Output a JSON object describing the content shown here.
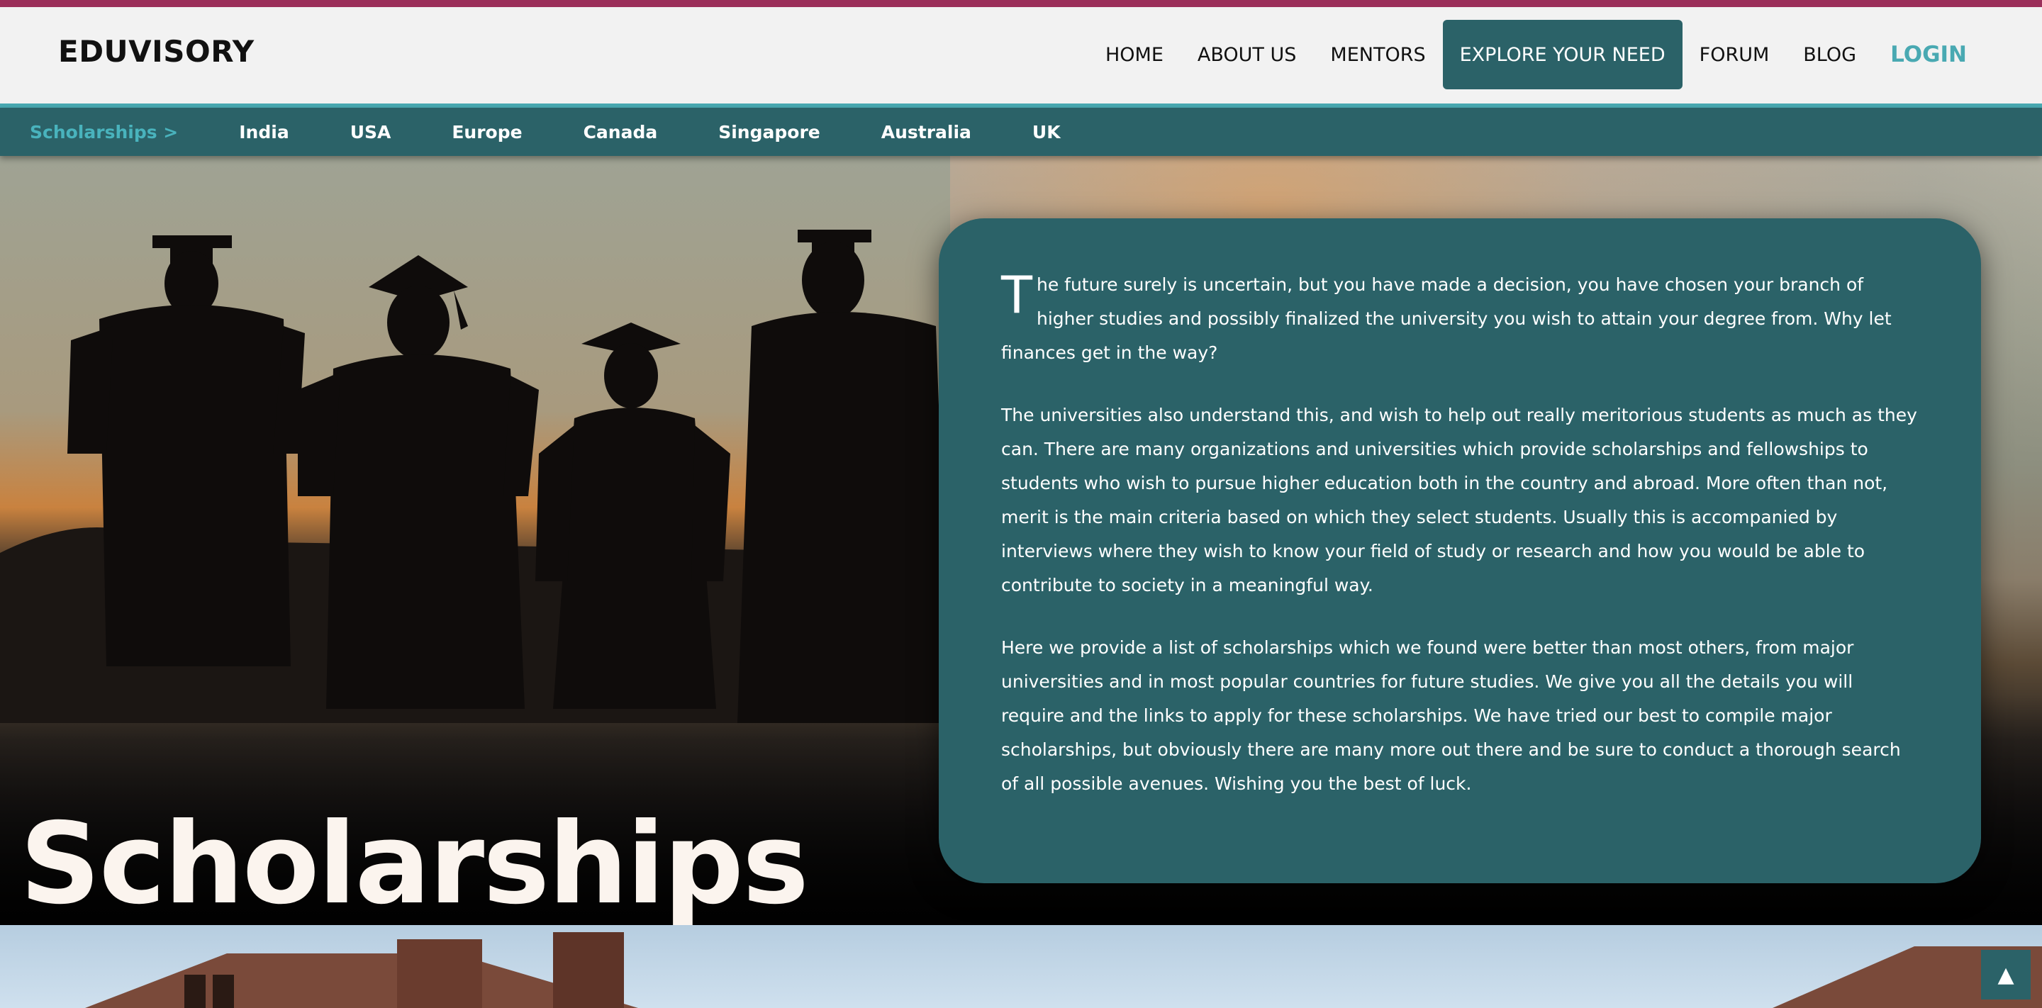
{
  "brand": "EDUVISORY",
  "nav": {
    "items": [
      "HOME",
      "ABOUT US",
      "MENTORS",
      "EXPLORE YOUR NEED",
      "FORUM",
      "BLOG"
    ],
    "login": "LOGIN"
  },
  "subnav": {
    "current": "Scholarships >",
    "items": [
      "India",
      "USA",
      "Europe",
      "Canada",
      "Singapore",
      "Australia",
      "UK"
    ]
  },
  "hero": {
    "title": "Scholarships"
  },
  "content": {
    "dropcap": "T",
    "p1_rest": "he future surely is uncertain, but you have made a decision, you have chosen your branch of higher studies and possibly finalized the university you wish to attain your degree from. Why let finances get in the way?",
    "p2": "The universities also understand this, and wish to help out really meritorious students as much as they can. There are many organizations and universities which provide scholarships and fellowships to students who wish to pursue higher education both in the country and abroad. More often than not, merit is the main criteria based on which they select students. Usually this is accompanied by interviews where they wish to know your field of study or research and how you would be able to contribute to society in a meaningful way.",
    "p3": "Here we provide a list of scholarships which we found were better than most others, from major universities and in most popular countries for future studies. We give you all the details you will require and the links to apply for these scholarships. We have tried our best to compile major scholarships, but obviously there are many more out there and be sure to conduct a thorough search of all possible avenues. Wishing you the best of luck."
  },
  "scroll_top": {
    "icon": "arrow-up-icon",
    "glyph": "▲"
  },
  "colors": {
    "accent": "#2b6268",
    "highlight": "#49a9b2",
    "top_stripe": "#9b2f5a"
  }
}
